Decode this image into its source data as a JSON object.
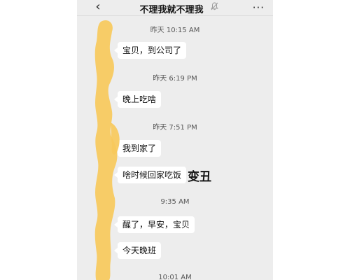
{
  "header": {
    "back_icon": "‹",
    "title": "不理我就不理我",
    "mute_icon": "🔕",
    "more_icon": "···"
  },
  "messages": [
    {
      "time": "昨天 10:15 AM",
      "text": "宝贝，到公司了"
    },
    {
      "time": "昨天 6:19 PM",
      "text": "晚上吃啥"
    },
    {
      "time": "昨天 7:51 PM",
      "text": "我到家了"
    },
    {
      "text": "啥时候回家吃饭"
    },
    {
      "time": "9:35 AM",
      "text": "醒了，早安，宝贝"
    },
    {
      "text": "今天晚班"
    },
    {
      "time": "10:01 AM"
    }
  ],
  "sticker_text": "变丑",
  "colors": {
    "chat_background": "#ededed",
    "bubble": "#ffffff",
    "redaction": "#f7c95b"
  }
}
